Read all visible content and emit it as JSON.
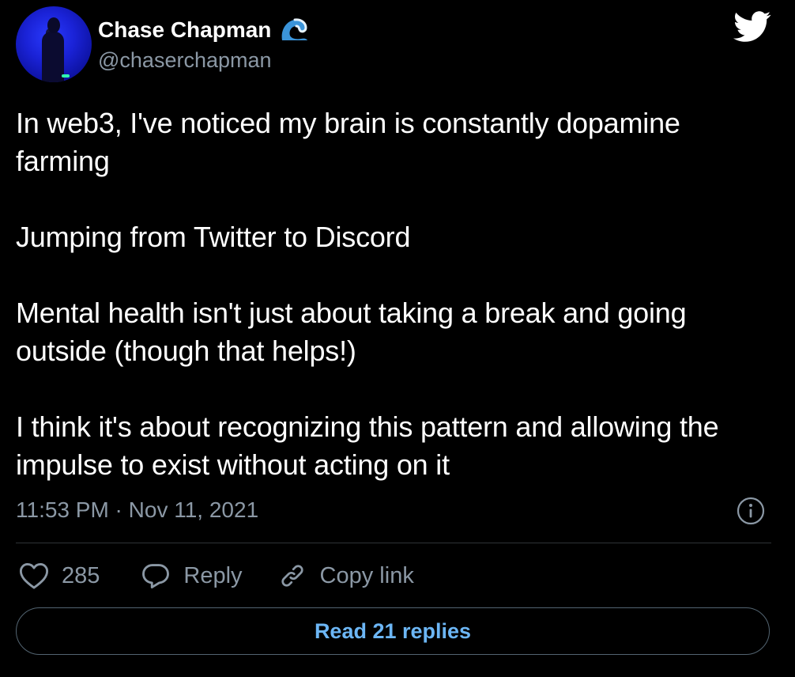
{
  "author": {
    "display_name": "Chase Chapman",
    "handle": "@chaserchapman",
    "verified_emoji": "wave-icon"
  },
  "tweet": {
    "paragraphs": [
      "In web3, I've noticed my brain is constantly dopamine farming",
      "Jumping from Twitter to Discord",
      "Mental health isn't just about taking a break and going outside (though that helps!)",
      "I think it's about recognizing this pattern and allowing the impulse to exist without acting on it"
    ],
    "timestamp": "11:53 PM · Nov 11, 2021"
  },
  "actions": {
    "like_count": "285",
    "reply_label": "Reply",
    "copy_link_label": "Copy link"
  },
  "footer": {
    "read_replies_label": "Read 21 replies"
  },
  "colors": {
    "background": "#000000",
    "text_primary": "#ffffff",
    "text_secondary": "#8b98a5",
    "accent": "#6cb6f5",
    "divider": "#2f3336"
  }
}
